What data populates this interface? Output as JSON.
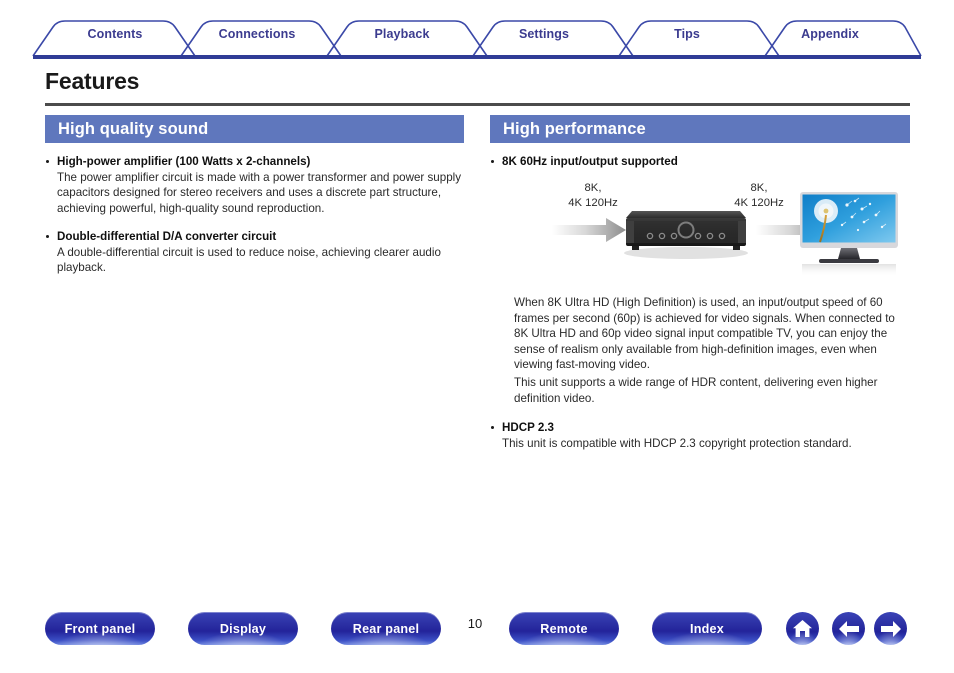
{
  "nav": {
    "tabs": [
      {
        "label": "Contents"
      },
      {
        "label": "Connections"
      },
      {
        "label": "Playback"
      },
      {
        "label": "Settings"
      },
      {
        "label": "Tips"
      },
      {
        "label": "Appendix"
      }
    ],
    "accent_color": "#3b3b8f",
    "rule_color": "#2f3c96"
  },
  "page": {
    "title": "Features",
    "number": "10"
  },
  "left_column": {
    "header": "High quality sound",
    "header_bg": "#5f77bd",
    "items": [
      {
        "title": "High-power amplifier (100 Watts x 2-channels)",
        "body": "The power amplifier circuit is made with a power transformer and power supply capacitors designed for stereo receivers and uses a discrete part structure, achieving powerful, high-quality sound reproduction."
      },
      {
        "title": "Double-differential D/A converter circuit",
        "body": "A double-differential circuit is used to reduce noise, achieving clearer audio playback."
      }
    ]
  },
  "right_column": {
    "header": "High performance",
    "header_bg": "#5f77bd",
    "items": [
      {
        "title": "8K 60Hz input/output supported",
        "diagram": {
          "input_label": "8K,\n4K 120Hz",
          "output_label": "8K,\n4K 120Hz",
          "source_icon": "arrow-right-gradient-icon",
          "device_icon": "av-receiver-icon",
          "display_icon": "television-icon"
        },
        "paragraphs": [
          "When 8K Ultra HD (High Definition) is used, an input/output speed of 60 frames per second (60p) is achieved for video signals. When connected to 8K Ultra HD and 60p video signal input compatible TV, you can enjoy the sense of realism only available from high-definition images, even when viewing fast-moving video.",
          "This unit supports a wide range of HDR content, delivering even higher definition video."
        ]
      },
      {
        "title": "HDCP 2.3",
        "body": "This unit is compatible with HDCP 2.3 copyright protection standard."
      }
    ]
  },
  "footer": {
    "buttons": [
      {
        "label": "Front panel"
      },
      {
        "label": "Display"
      },
      {
        "label": "Rear panel"
      },
      {
        "label": "Remote"
      },
      {
        "label": "Index"
      }
    ],
    "icon_buttons": [
      {
        "icon": "home-icon"
      },
      {
        "icon": "arrow-left-icon"
      },
      {
        "icon": "arrow-right-icon"
      }
    ]
  }
}
